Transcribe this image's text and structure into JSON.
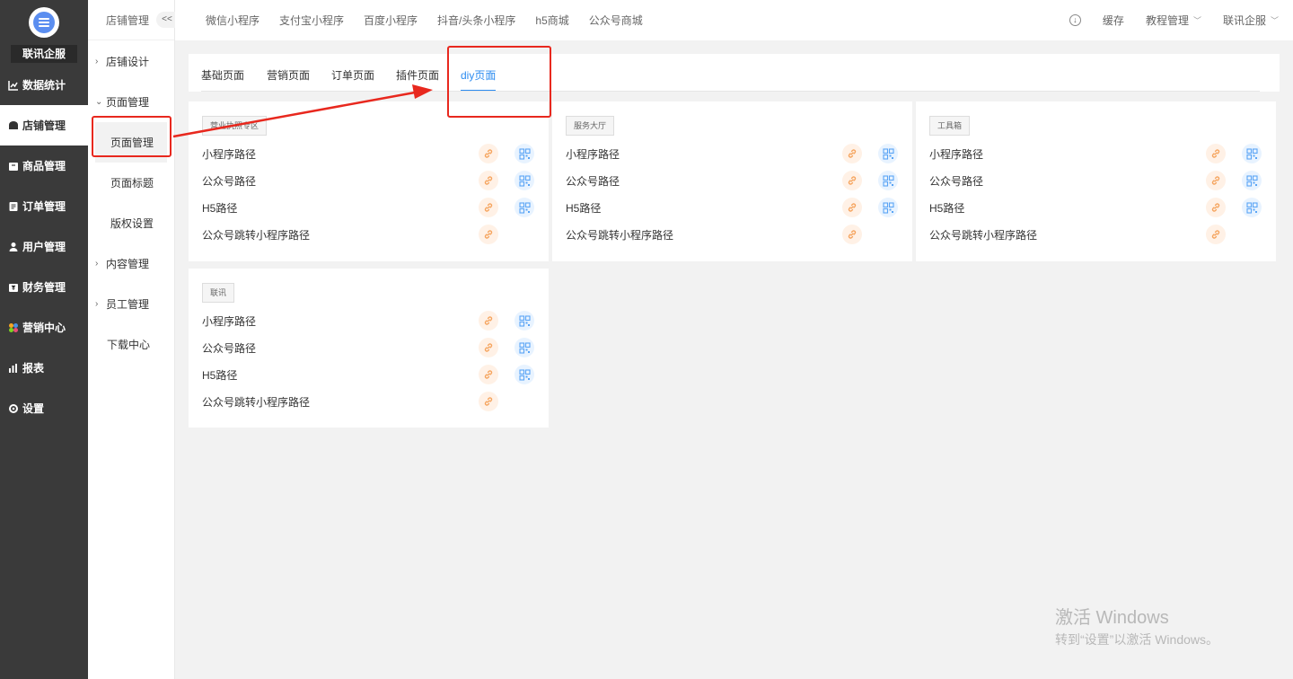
{
  "sidebar": {
    "brand": "联讯企服",
    "items": [
      {
        "label": "数据统计",
        "icon": "chart-line-icon",
        "active": false
      },
      {
        "label": "店铺管理",
        "icon": "store-icon",
        "active": true
      },
      {
        "label": "商品管理",
        "icon": "product-icon",
        "active": false
      },
      {
        "label": "订单管理",
        "icon": "order-icon",
        "active": false
      },
      {
        "label": "用户管理",
        "icon": "user-icon",
        "active": false
      },
      {
        "label": "财务管理",
        "icon": "finance-icon",
        "active": false
      },
      {
        "label": "营销中心",
        "icon": "marketing-icon",
        "active": false
      },
      {
        "label": "报表",
        "icon": "report-icon",
        "active": false
      },
      {
        "label": "设置",
        "icon": "gear-icon",
        "active": false
      }
    ]
  },
  "subnav": {
    "title": "店铺管理",
    "collapse": "<<",
    "items": [
      {
        "label": "店铺设计"
      },
      {
        "label": "页面管理"
      },
      {
        "label": "页面管理"
      },
      {
        "label": "页面标题"
      },
      {
        "label": "版权设置"
      },
      {
        "label": "内容管理"
      },
      {
        "label": "员工管理"
      },
      {
        "label": "下载中心"
      }
    ]
  },
  "topbar": {
    "tabs": [
      "微信小程序",
      "支付宝小程序",
      "百度小程序",
      "抖音/头条小程序",
      "h5商城",
      "公众号商城"
    ],
    "cache": "缓存",
    "tutorial": "教程管理",
    "account": "联讯企服"
  },
  "page_tabs": [
    {
      "label": "基础页面",
      "active": false
    },
    {
      "label": "营销页面",
      "active": false
    },
    {
      "label": "订单页面",
      "active": false
    },
    {
      "label": "插件页面",
      "active": false
    },
    {
      "label": "diy页面",
      "active": true
    }
  ],
  "cards": [
    {
      "tag": "营业执照专区",
      "rows": [
        "小程序路径",
        "公众号路径",
        "H5路径",
        "公众号跳转小程序路径"
      ]
    },
    {
      "tag": "服务大厅",
      "rows": [
        "小程序路径",
        "公众号路径",
        "H5路径",
        "公众号跳转小程序路径"
      ]
    },
    {
      "tag": "工具箱",
      "rows": [
        "小程序路径",
        "公众号路径",
        "H5路径",
        "公众号跳转小程序路径"
      ]
    },
    {
      "tag": "联讯",
      "rows": [
        "小程序路径",
        "公众号路径",
        "H5路径",
        "公众号跳转小程序路径"
      ]
    }
  ],
  "watermark": {
    "line1": "激活 Windows",
    "line2": "转到“设置”以激活 Windows。"
  },
  "colors": {
    "sidebar_bg": "#3a3a3a",
    "accent": "#2d8cf0",
    "link_icon": "#f5a35c",
    "qr_icon": "#5aa4f5",
    "annotation_red": "#e8281e"
  }
}
